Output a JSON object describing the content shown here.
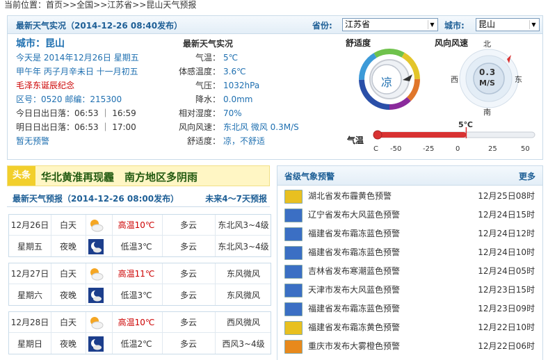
{
  "breadcrumb": {
    "prefix": "当前位置：",
    "home": "首页",
    "sep": ">>",
    "all": "全国",
    "province": "江苏省",
    "page": "昆山天气预报"
  },
  "live": {
    "title": "最新天气实况（2014-12-26 08:40发布）",
    "province_label": "省份:",
    "province_value": "江苏省",
    "city_label": "城市:",
    "city_value": "昆山",
    "city_title": "城市：昆山",
    "date_line": "今天是 2014年12月26日 星期五",
    "lunar_line": "甲午年 丙子月辛未日 十一月初五",
    "memorial": "毛泽东诞辰纪念",
    "codes": "区号：0520 邮编：215300",
    "sun_today": "今日日出日落：06:53 ｜ 16:59",
    "sun_tomorrow": "明日日出日落：06:53 ｜ 17:00",
    "alert_status": "暂无预警",
    "obs_title": "最新天气实况",
    "obs": [
      {
        "k": "气温：",
        "v": "5℃"
      },
      {
        "k": "体感温度：",
        "v": "3.6℃"
      },
      {
        "k": "气压：",
        "v": "1032hPa"
      },
      {
        "k": "降水：",
        "v": "0.0mm"
      },
      {
        "k": "相对湿度：",
        "v": "70%"
      },
      {
        "k": "风向风速：",
        "v": "东北风 微风 0.3M/S"
      },
      {
        "k": "舒适度：",
        "v": "凉，不舒适"
      }
    ],
    "comfort_title": "舒适度",
    "comfort_value": "凉",
    "wind_title": "风向风速",
    "wind_value": "0.3",
    "wind_unit": "M/S",
    "dir_n": "北",
    "dir_s": "南",
    "dir_e": "东",
    "dir_w": "西",
    "temp_label": "气温",
    "temp_reading": "5℃",
    "temp_value": 5,
    "temp_range": [
      -50,
      50
    ],
    "temp_ticks": [
      "C",
      "-50",
      "-25",
      "0",
      "25",
      "50"
    ]
  },
  "banner": {
    "tag": "头条",
    "text": "华北黄淮再现霾　南方地区多阴雨"
  },
  "forecast": {
    "title": "最新天气预报（2014-12-26 08:00发布）",
    "more": "未来4～7天预报",
    "days": [
      {
        "date": "12月26日",
        "week": "星期五",
        "day_label": "白天",
        "night_label": "夜晚",
        "high": "高温10℃",
        "low": "低温3℃",
        "day_sky": "多云",
        "night_sky": "多云",
        "day_wind": "东北风3~4级",
        "night_wind": "东北风3~4级",
        "day_icon": "partly-cloudy-day-icon",
        "night_icon": "cloudy-night-icon"
      },
      {
        "date": "12月27日",
        "week": "星期六",
        "day_label": "白天",
        "night_label": "夜晚",
        "high": "高温11℃",
        "low": "低温3℃",
        "day_sky": "多云",
        "night_sky": "多云",
        "day_wind": "东风微风",
        "night_wind": "东风微风",
        "day_icon": "partly-cloudy-day-icon",
        "night_icon": "cloudy-night-icon"
      },
      {
        "date": "12月28日",
        "week": "星期日",
        "day_label": "白天",
        "night_label": "夜晚",
        "high": "高温10℃",
        "low": "低温2℃",
        "day_sky": "多云",
        "night_sky": "多云",
        "day_wind": "西风微风",
        "night_wind": "西风3~4级",
        "day_icon": "partly-cloudy-day-icon",
        "night_icon": "cloudy-night-icon"
      }
    ]
  },
  "warnings": {
    "title": "省级气象预警",
    "more": "更多",
    "items": [
      {
        "text": "湖北省发布霾黄色预警",
        "time": "12月25日08时",
        "color": "#e8c020"
      },
      {
        "text": "辽宁省发布大风蓝色预警",
        "time": "12月24日15时",
        "color": "#3b6fc4"
      },
      {
        "text": "福建省发布霜冻蓝色预警",
        "time": "12月24日12时",
        "color": "#3b6fc4"
      },
      {
        "text": "福建省发布霜冻蓝色预警",
        "time": "12月24日10时",
        "color": "#3b6fc4"
      },
      {
        "text": "吉林省发布寒潮蓝色预警",
        "time": "12月24日05时",
        "color": "#3b6fc4"
      },
      {
        "text": "天津市发布大风蓝色预警",
        "time": "12月23日15时",
        "color": "#3b6fc4"
      },
      {
        "text": "福建省发布霜冻蓝色预警",
        "time": "12月23日09时",
        "color": "#3b6fc4"
      },
      {
        "text": "福建省发布霜冻黄色预警",
        "time": "12月22日10时",
        "color": "#e8c020"
      },
      {
        "text": "重庆市发布大雾橙色预警",
        "time": "12月22日06时",
        "color": "#e8891c"
      }
    ]
  }
}
